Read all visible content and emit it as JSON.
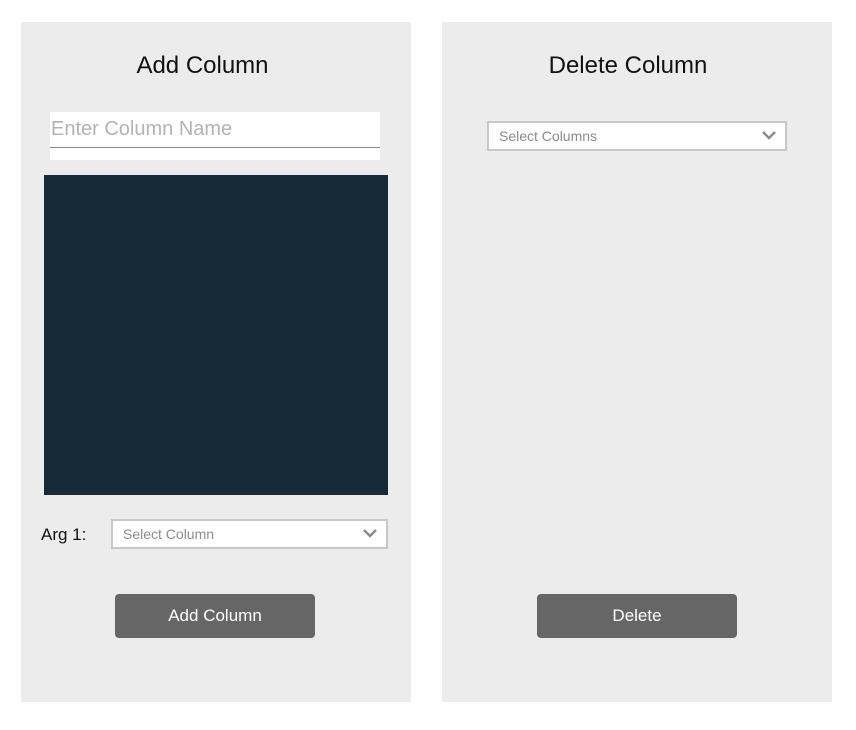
{
  "add_panel": {
    "title": "Add Column",
    "name_input": {
      "value": "",
      "placeholder": "Enter Column Name"
    },
    "arg1": {
      "label": "Arg 1:",
      "select_placeholder": "Select Column"
    },
    "submit_label": "Add Column"
  },
  "delete_panel": {
    "title": "Delete Column",
    "select_placeholder": "Select Columns",
    "submit_label": "Delete"
  },
  "icons": {
    "dropdown": "chevron-down-icon"
  },
  "colors": {
    "panel_bg": "#ececec",
    "editor_bg": "#162a38",
    "button_bg": "#666666",
    "button_text": "#ffffff"
  }
}
